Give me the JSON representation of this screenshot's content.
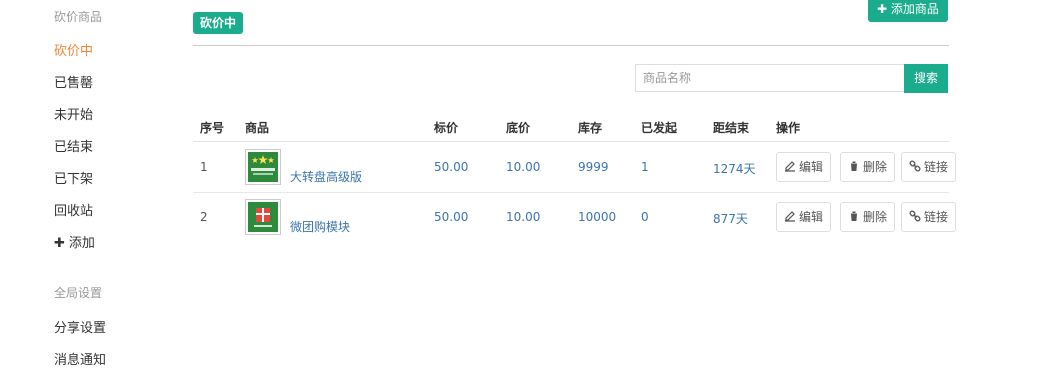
{
  "sidebar": {
    "section_goods": "砍价商品",
    "items": [
      {
        "label": "砍价中"
      },
      {
        "label": "已售罄"
      },
      {
        "label": "未开始"
      },
      {
        "label": "已结束"
      },
      {
        "label": "已下架"
      },
      {
        "label": "回收站"
      },
      {
        "label": "添加"
      }
    ],
    "section_global": "全局设置",
    "global_items": [
      {
        "label": "分享设置"
      },
      {
        "label": "消息通知"
      }
    ]
  },
  "main": {
    "badge": "砍价中",
    "add_button": "添加商品",
    "search_placeholder": "商品名称",
    "search_button": "搜索",
    "table": {
      "headers": [
        "序号",
        "商品",
        "标价",
        "底价",
        "库存",
        "已发起",
        "距结束",
        "操作"
      ],
      "rows": [
        {
          "index": "1",
          "name": "大转盘高级版",
          "price": "50.00",
          "floor": "10.00",
          "stock": "9999",
          "started": "1",
          "ends_in": "1274天",
          "thumb_icon": "wheel-stars-icon"
        },
        {
          "index": "2",
          "name": "微团购模块",
          "price": "50.00",
          "floor": "10.00",
          "stock": "10000",
          "started": "0",
          "ends_in": "877天",
          "thumb_icon": "gift-box-icon"
        }
      ],
      "actions": {
        "edit": "编辑",
        "delete": "删除",
        "link": "链接"
      }
    }
  },
  "colors": {
    "accent": "#1aac8c",
    "active": "#f0883a",
    "link": "#3a75b0"
  }
}
